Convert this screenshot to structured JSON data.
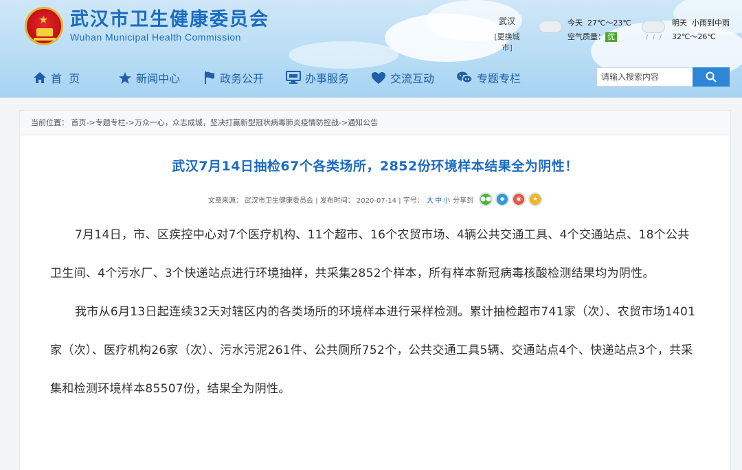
{
  "header": {
    "title_cn": "武汉市卫生健康委员会",
    "title_en": "Wuhan Municipal Health Commission",
    "weather": {
      "city": "武汉",
      "change_city": "[更换城市]",
      "today_label": "今天",
      "today_temp": "27℃～23℃",
      "air_quality_label": "空气质量：",
      "air_quality_value": "优",
      "tomorrow_label": "明天",
      "tomorrow_desc": "小雨到中雨",
      "tomorrow_temp": "32℃～26℃"
    }
  },
  "nav": {
    "items": [
      {
        "label": "首  页",
        "icon": "home-icon"
      },
      {
        "label": "新闻中心",
        "icon": "star-icon"
      },
      {
        "label": "政务公开",
        "icon": "flag-icon"
      },
      {
        "label": "办事服务",
        "icon": "monitor-icon"
      },
      {
        "label": "交流互动",
        "icon": "heart-icon"
      },
      {
        "label": "专题专栏",
        "icon": "chat-icon"
      }
    ]
  },
  "search": {
    "placeholder": "请输入搜索内容"
  },
  "breadcrumb": "当前位置： 首页->专题专栏->万众一心，众志成城，坚决打赢新型冠状病毒肺炎疫情防控战->通知公告",
  "article": {
    "title": "武汉7月14日抽检67个各类场所，2852份环境样本结果全为阴性！",
    "meta": {
      "source": "文章来源： 武汉市卫生健康委员会 | 发布时间： 2020-07-14 | 字号：",
      "size_large": "大",
      "size_medium": "中",
      "size_small": "小",
      "share_label": "分享到"
    },
    "paragraphs": [
      "7月14日，市、区疾控中心对7个医疗机构、11个超市、16个农贸市场、4辆公共交通工具、4个交通站点、18个公共卫生间、4个污水厂、3个快递站点进行环境抽样，共采集2852个样本，所有样本新冠病毒核酸检测结果均为阴性。",
      "我市从6月13日起连续32天对辖区内的各类场所的环境样本进行采样检测。累计抽检超市741家（次）、农贸市场1401家（次）、医疗机构26家（次）、污水污泥261件、公共厕所752个，公共交通工具5辆、交通站点4个、快递站点3个，共采集和检测环境样本85507份，结果全为阴性。"
    ]
  },
  "colors": {
    "brand_blue": "#1a6cbf",
    "title_blue": "#1e6bc0",
    "search_button": "#2f86d6",
    "aqi_green": "#4aa832"
  }
}
